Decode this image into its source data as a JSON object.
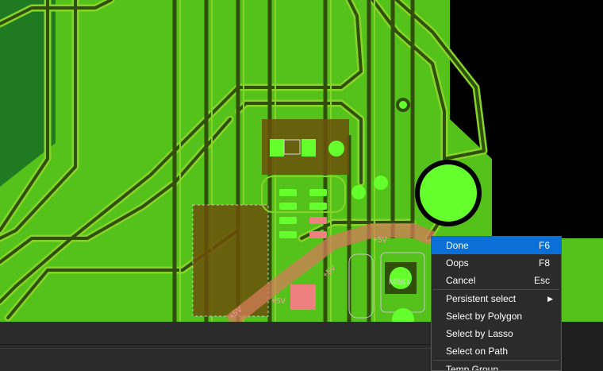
{
  "canvas": {
    "silkscreen_labels": [
      "+5V",
      "+5V",
      "+5V",
      "+5V"
    ],
    "pad_label": "MISO"
  },
  "context_menu": {
    "items": [
      {
        "label": "Done",
        "shortcut": "F6",
        "active": true
      },
      {
        "label": "Oops",
        "shortcut": "F8"
      },
      {
        "label": "Cancel",
        "shortcut": "Esc"
      },
      {
        "label": "Persistent select",
        "submenu": true
      },
      {
        "label": "Select by Polygon"
      },
      {
        "label": "Select by Lasso"
      },
      {
        "label": "Select on Path"
      },
      {
        "label": "Temp Group"
      }
    ]
  },
  "colors": {
    "board_green": "#55c21b",
    "trace_dark": "#2f4f0a",
    "trace_light": "#86d42a",
    "pad_green": "#66ff2e",
    "pad_pink": "#ef8080",
    "menu_highlight": "#0a6fd6"
  }
}
